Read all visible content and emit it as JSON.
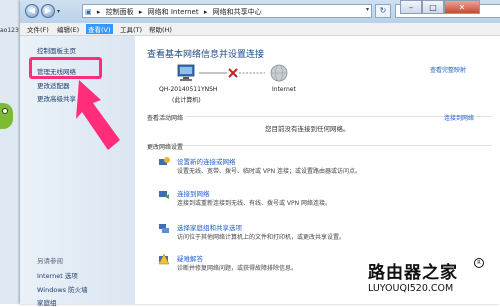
{
  "desktop": {
    "label": "ao123"
  },
  "addressbar": {
    "crumbs": [
      "控制面板",
      "网络和 Internet",
      "网络和共享中心"
    ],
    "sep": "▸"
  },
  "menu": {
    "file": "文件(F)",
    "edit": "编辑(E)",
    "view": "查看(V)",
    "tools": "工具(T)",
    "help": "帮助(H)"
  },
  "sidebar": {
    "items": [
      "控制面板主页",
      "管理无线网络",
      "更改适配器",
      "更改高级共享"
    ],
    "see_also": "另请参阅",
    "bottom": [
      "Internet 选项",
      "Windows 防火墙",
      "家庭组"
    ]
  },
  "main": {
    "title": "查看基本网络信息并设置连接",
    "full_map": "查看完整映射",
    "computer_name": "QH-20140511YNSH",
    "computer_sub": "(此计算机)",
    "internet_label": "Internet",
    "active_title": "查看活动网络",
    "connect_to": "连接到网络",
    "no_connection": "您目前没有连接到任何网络。",
    "settings_title": "更改网络设置",
    "tasks": [
      {
        "link": "设置新的连接或网络",
        "desc": "设置无线、宽带、拨号、临时或 VPN 连接；或设置路由器或访问点。"
      },
      {
        "link": "连接到网络",
        "desc": "连接到或重新连接到无线、有线、拨号或 VPN 网络连接。"
      },
      {
        "link": "选择家庭组和共享选项",
        "desc": "访问位于其他网络计算机上的文件和打印机，或更改共享设置。"
      },
      {
        "link": "疑难解答",
        "desc": "诊断并修复网络问题，或获得故障排除信息。"
      }
    ]
  },
  "watermark": {
    "cn": "路由器之家",
    "en": "LUYOUQI520.COM",
    "mark": "R"
  },
  "colors": {
    "highlight": "#ff2d7a",
    "link": "#1e5ccc",
    "title": "#1e4a88",
    "sidebar": "#dbe6f2"
  }
}
